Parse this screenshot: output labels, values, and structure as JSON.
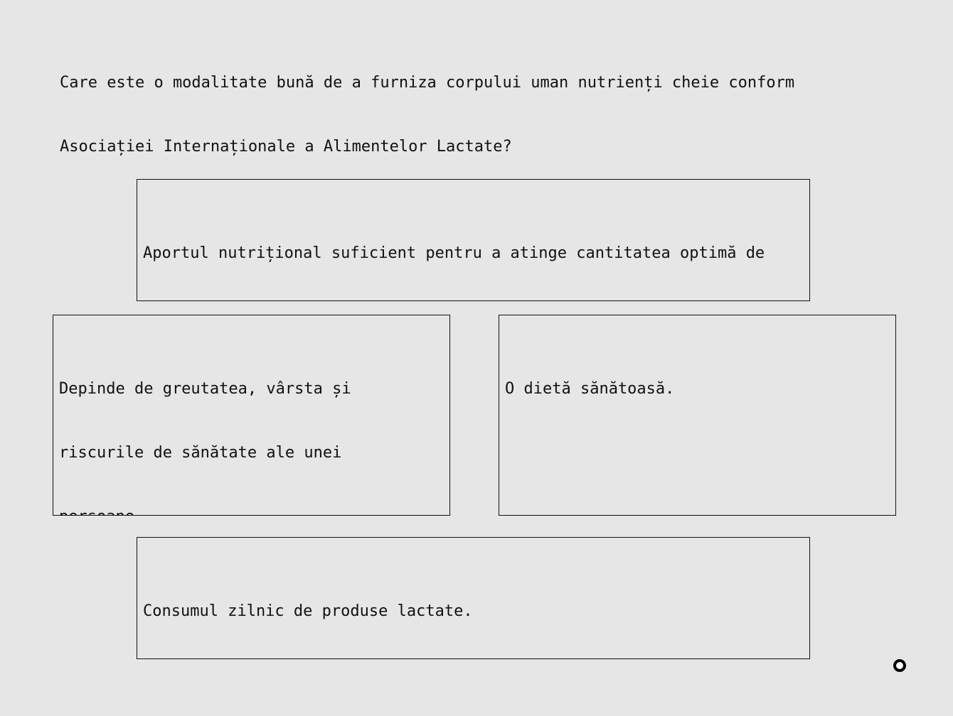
{
  "question": "Care este o modalitate bună de a furniza corpului uman nutrienți cheie conform\nAsociației Internaționale a Alimentelor Lactate?",
  "options": [
    {
      "id": "a",
      "text": "Aportul nutrițional suficient pentru a atinge cantitatea optimă de\nvitamine și minerale."
    },
    {
      "id": "b",
      "text": "Depinde de greutatea, vârsta și\nriscurile de sănătate ale unei\npersoane."
    },
    {
      "id": "c",
      "text": "O dietă sănătoasă."
    },
    {
      "id": "d",
      "text": "Consumul zilnic de produse lactate."
    }
  ],
  "cursor": {
    "icon": "cursor-ring-icon"
  }
}
